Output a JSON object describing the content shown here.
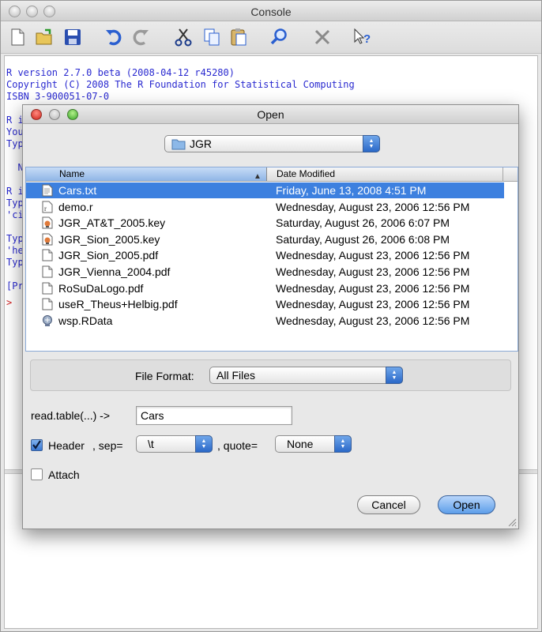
{
  "console": {
    "title": "Console",
    "toolbar": [
      {
        "icon": "new-document-icon"
      },
      {
        "icon": "open-folder-icon"
      },
      {
        "icon": "save-icon"
      },
      {
        "icon": "undo-icon"
      },
      {
        "icon": "redo-icon"
      },
      {
        "icon": "cut-icon"
      },
      {
        "icon": "copy-icon"
      },
      {
        "icon": "paste-icon"
      },
      {
        "icon": "find-icon"
      },
      {
        "icon": "clear-icon"
      },
      {
        "icon": "help-icon"
      }
    ],
    "lines": [
      "R version 2.7.0 beta (2008-04-12 r45280)",
      "Copyright (C) 2008 The R Foundation for Statistical Computing",
      "ISBN 3-900051-07-0",
      "",
      "R i",
      "You",
      "Typ",
      "",
      "  N",
      "",
      "R i",
      "Typ",
      "'ci",
      "",
      "Typ",
      "'he",
      "Typ",
      "",
      "[Pr"
    ],
    "prompt": ">",
    "colors": {
      "text": "#2a2ad0",
      "prompt": "#d02020"
    }
  },
  "dialog": {
    "title": "Open",
    "location": {
      "value": "JGR",
      "icon": "folder-icon"
    },
    "columns": {
      "name": "Name",
      "date": "Date Modified"
    },
    "files": [
      {
        "name": "Cars.txt",
        "date": "Friday, June 13, 2008 4:51 PM",
        "icon": "text-file-icon",
        "selected": true
      },
      {
        "name": "demo.r",
        "date": "Wednesday, August 23, 2006 12:56 PM",
        "icon": "r-file-icon",
        "selected": false
      },
      {
        "name": "JGR_AT&T_2005.key",
        "date": "Saturday, August 26, 2006 6:07 PM",
        "icon": "keynote-file-icon",
        "selected": false
      },
      {
        "name": "JGR_Sion_2005.key",
        "date": "Saturday, August 26, 2006 6:08 PM",
        "icon": "keynote-file-icon",
        "selected": false
      },
      {
        "name": "JGR_Sion_2005.pdf",
        "date": "Wednesday, August 23, 2006 12:56 PM",
        "icon": "document-file-icon",
        "selected": false
      },
      {
        "name": "JGR_Vienna_2004.pdf",
        "date": "Wednesday, August 23, 2006 12:56 PM",
        "icon": "document-file-icon",
        "selected": false
      },
      {
        "name": "RoSuDaLogo.pdf",
        "date": "Wednesday, August 23, 2006 12:56 PM",
        "icon": "document-file-icon",
        "selected": false
      },
      {
        "name": "useR_Theus+Helbig.pdf",
        "date": "Wednesday, August 23, 2006 12:56 PM",
        "icon": "document-file-icon",
        "selected": false
      },
      {
        "name": "wsp.RData",
        "date": "Wednesday, August 23, 2006 12:56 PM",
        "icon": "rdata-file-icon",
        "selected": false
      }
    ],
    "file_format": {
      "label": "File Format:",
      "value": "All Files"
    },
    "read_table": {
      "label": "read.table(...) ->",
      "value": "Cars"
    },
    "header": {
      "label": "Header",
      "checked": true
    },
    "sep": {
      "label": ", sep=",
      "value": "\\t"
    },
    "quote": {
      "label": ", quote=",
      "value": "None"
    },
    "attach": {
      "label": "Attach",
      "checked": false
    },
    "buttons": {
      "cancel": "Cancel",
      "open": "Open"
    },
    "colors": {
      "selection": "#3d80df",
      "default_button": "#5d9ee9"
    }
  }
}
